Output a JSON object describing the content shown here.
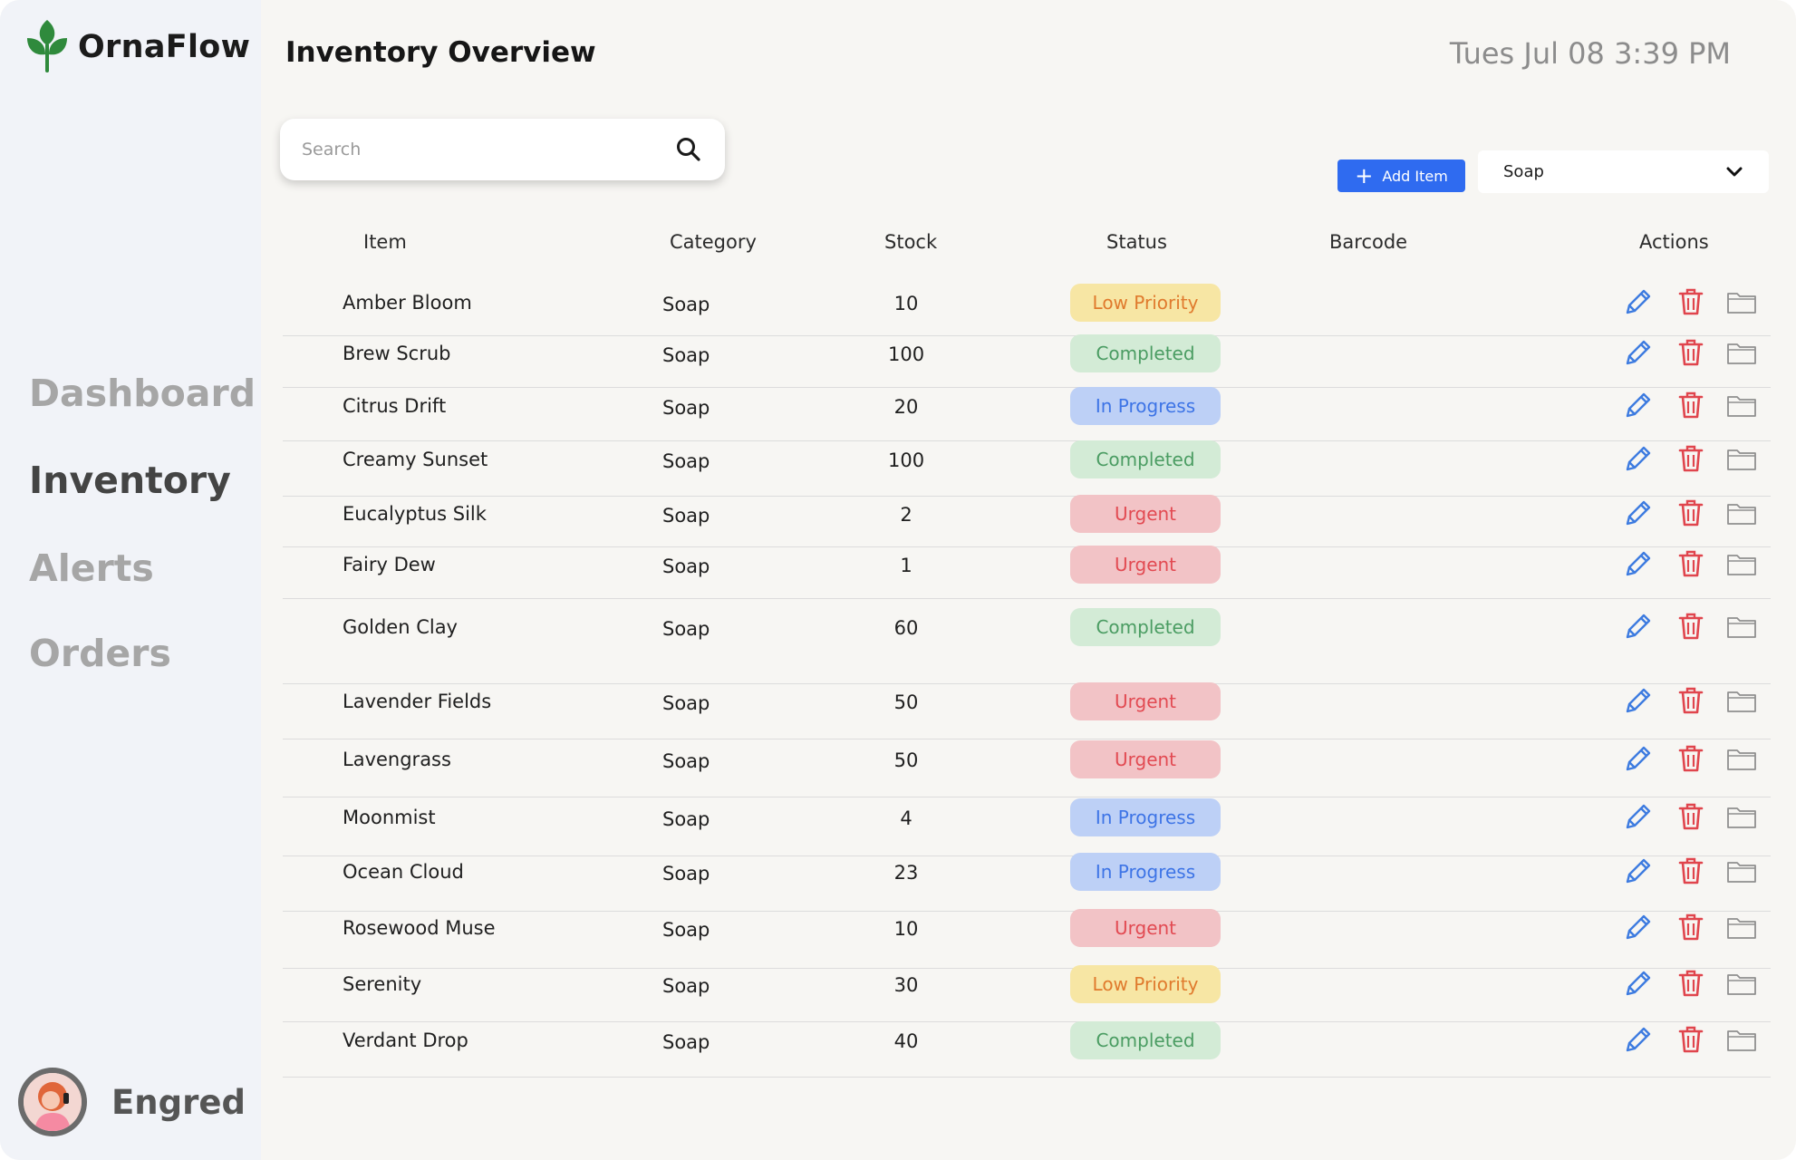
{
  "brand": {
    "name": "OrnaFlow",
    "logo_icon": "leaf-icon",
    "color": "#2f8a3c"
  },
  "sidebar": {
    "items": [
      {
        "label": "Dashboard",
        "active": false
      },
      {
        "label": "Inventory",
        "active": true
      },
      {
        "label": "Alerts",
        "active": false
      },
      {
        "label": "Orders",
        "active": false
      }
    ],
    "user": {
      "name": "Engred"
    }
  },
  "header": {
    "title": "Inventory Overview",
    "datetime": "Tues Jul 08 3:39 PM"
  },
  "search": {
    "placeholder": "Search",
    "value": ""
  },
  "toolbar": {
    "add_label": "Add Item",
    "add_color": "#2f6bf0",
    "category_filter": "Soap"
  },
  "table": {
    "columns": [
      "Item",
      "Category",
      "Stock",
      "Status",
      "Barcode",
      "Actions"
    ],
    "status_colors": {
      "Low Priority": {
        "bg": "#f7e6a4",
        "fg": "#e07a2d"
      },
      "Completed": {
        "bg": "#d3ebd6",
        "fg": "#4a9c62"
      },
      "In Progress": {
        "bg": "#bdd0f6",
        "fg": "#3d74e6"
      },
      "Urgent": {
        "bg": "#f2c3c6",
        "fg": "#e24a52"
      }
    },
    "rows": [
      {
        "item": "Amber Bloom",
        "category": "Soap",
        "stock": "10",
        "status": "Low Priority",
        "barcode": ""
      },
      {
        "item": "Brew Scrub",
        "category": "Soap",
        "stock": "100",
        "status": "Completed",
        "barcode": ""
      },
      {
        "item": "Citrus Drift",
        "category": "Soap",
        "stock": "20",
        "status": "In Progress",
        "barcode": ""
      },
      {
        "item": "Creamy Sunset",
        "category": "Soap",
        "stock": "100",
        "status": "Completed",
        "barcode": ""
      },
      {
        "item": "Eucalyptus Silk",
        "category": "Soap",
        "stock": "2",
        "status": "Urgent",
        "barcode": ""
      },
      {
        "item": "Fairy Dew",
        "category": "Soap",
        "stock": "1",
        "status": "Urgent",
        "barcode": ""
      },
      {
        "item": "Golden Clay",
        "category": "Soap",
        "stock": "60",
        "status": "Completed",
        "barcode": ""
      },
      {
        "item": "Lavender Fields",
        "category": "Soap",
        "stock": "50",
        "status": "Urgent",
        "barcode": ""
      },
      {
        "item": "Lavengrass",
        "category": "Soap",
        "stock": "50",
        "status": "Urgent",
        "barcode": ""
      },
      {
        "item": "Moonmist",
        "category": "Soap",
        "stock": "4",
        "status": "In Progress",
        "barcode": ""
      },
      {
        "item": "Ocean Cloud",
        "category": "Soap",
        "stock": "23",
        "status": "In Progress",
        "barcode": ""
      },
      {
        "item": "Rosewood Muse",
        "category": "Soap",
        "stock": "10",
        "status": "Urgent",
        "barcode": ""
      },
      {
        "item": "Serenity",
        "category": "Soap",
        "stock": "30",
        "status": "Low Priority",
        "barcode": ""
      },
      {
        "item": "Verdant Drop",
        "category": "Soap",
        "stock": "40",
        "status": "Completed",
        "barcode": ""
      }
    ],
    "action_icons": [
      "edit-pencil-icon",
      "delete-trash-icon",
      "folder-icon"
    ],
    "action_colors": {
      "edit": "#3d7be0",
      "delete": "#e0454d",
      "folder": "#8f8f8f"
    }
  }
}
